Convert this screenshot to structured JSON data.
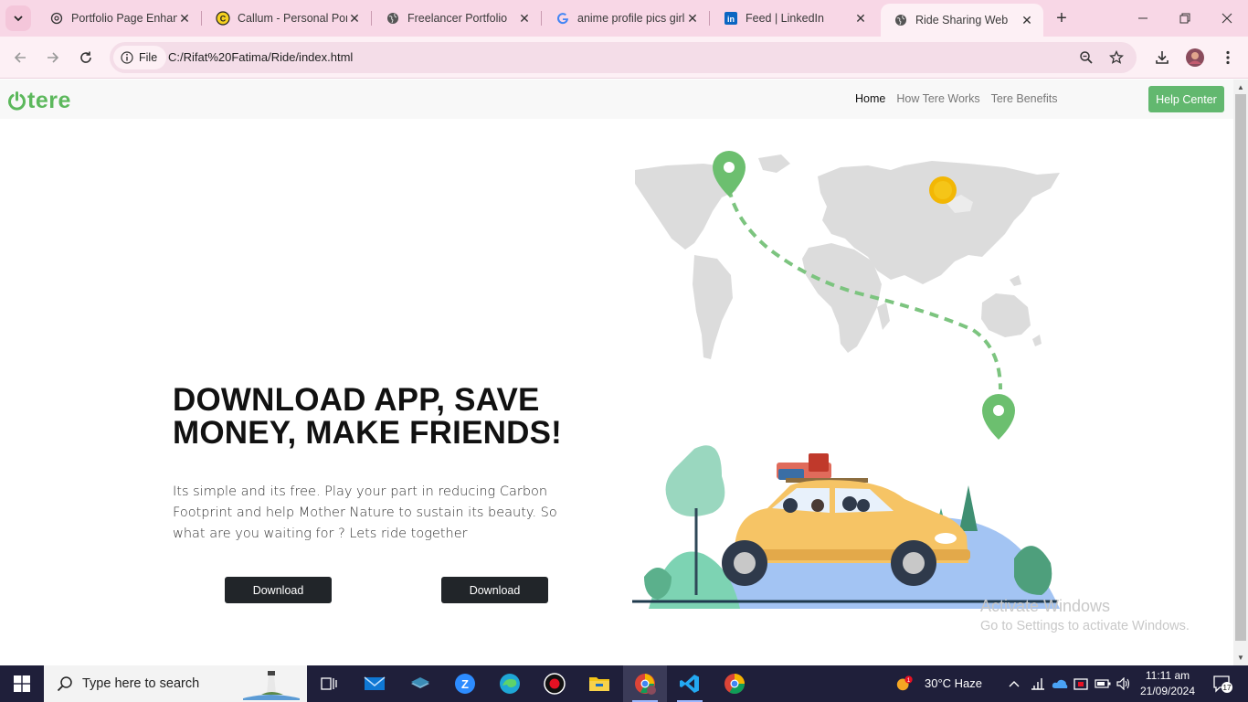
{
  "browser": {
    "tabs": [
      {
        "title": "Portfolio Page Enhanc",
        "icon": "openai-icon"
      },
      {
        "title": "Callum - Personal Por",
        "icon": "callum-icon"
      },
      {
        "title": "Freelancer Portfolio",
        "icon": "globe-icon"
      },
      {
        "title": "anime profile pics girl",
        "icon": "google-icon"
      },
      {
        "title": "Feed | LinkedIn",
        "icon": "linkedin-icon"
      },
      {
        "title": "Ride Sharing Web",
        "icon": "globe-icon",
        "active": true
      }
    ],
    "address": {
      "scheme_label": "File",
      "url": "C:/Rifat%20Fatima/Ride/index.html"
    }
  },
  "site": {
    "logo_text": "tere",
    "nav": [
      "Home",
      "How Tere Works",
      "Tere Benefits"
    ],
    "help_button": "Help Center",
    "hero": {
      "title": "DOWNLOAD APP, SAVE MONEY, MAKE FRIENDS!",
      "text": "Its simple and its free. Play your part in reducing Carbon Footprint and help Mother Nature to sustain its beauty. So what are you waiting for ? Lets ride together",
      "buttons": [
        "Download",
        "Download"
      ]
    },
    "accent_color": "#5cb85c"
  },
  "watermark": {
    "line1": "Activate Windows",
    "line2": "Go to Settings to activate Windows."
  },
  "taskbar": {
    "search_placeholder": "Type here to search",
    "weather": "30°C  Haze",
    "time": "11:11 am",
    "date": "21/09/2024",
    "notification_count": "17",
    "weather_badge": "1"
  }
}
